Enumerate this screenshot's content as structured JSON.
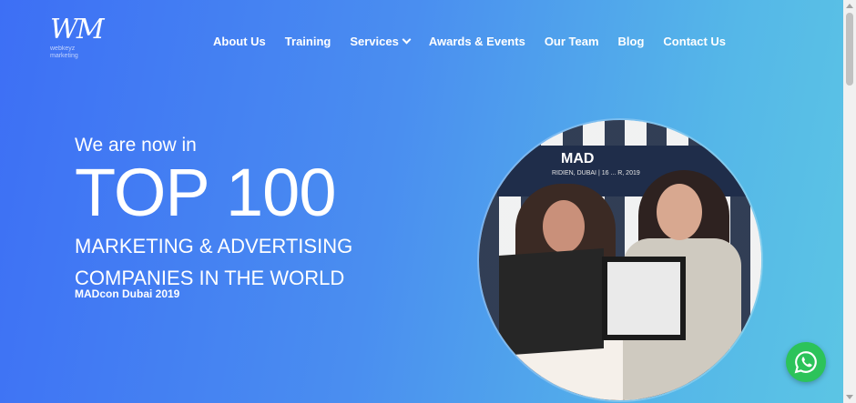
{
  "logo": {
    "mark": "WM",
    "tagline": "webkeyz\nmarketing"
  },
  "nav": [
    {
      "label": "About Us"
    },
    {
      "label": "Training"
    },
    {
      "label": "Services"
    },
    {
      "label": "Awards & Events"
    },
    {
      "label": "Our Team"
    },
    {
      "label": "Blog"
    },
    {
      "label": "Contact Us"
    }
  ],
  "hero": {
    "intro": "We are now in",
    "headline": "TOP 100",
    "line1": "MARKETING & ADVERTISING",
    "line2": "COMPANIES IN THE WORLD",
    "caption": "MADcon Dubai 2019"
  },
  "photo": {
    "banner_text": "MAD",
    "banner_sub": "RIDIEN, DUBAI | 16 ... R, 2019"
  },
  "icons": {
    "dropdown": "chevron-down-icon",
    "chat": "whatsapp-icon"
  },
  "colors": {
    "bg_left": "#3d6ff5",
    "bg_right": "#5cc6e4",
    "whatsapp": "#2cc35a"
  }
}
